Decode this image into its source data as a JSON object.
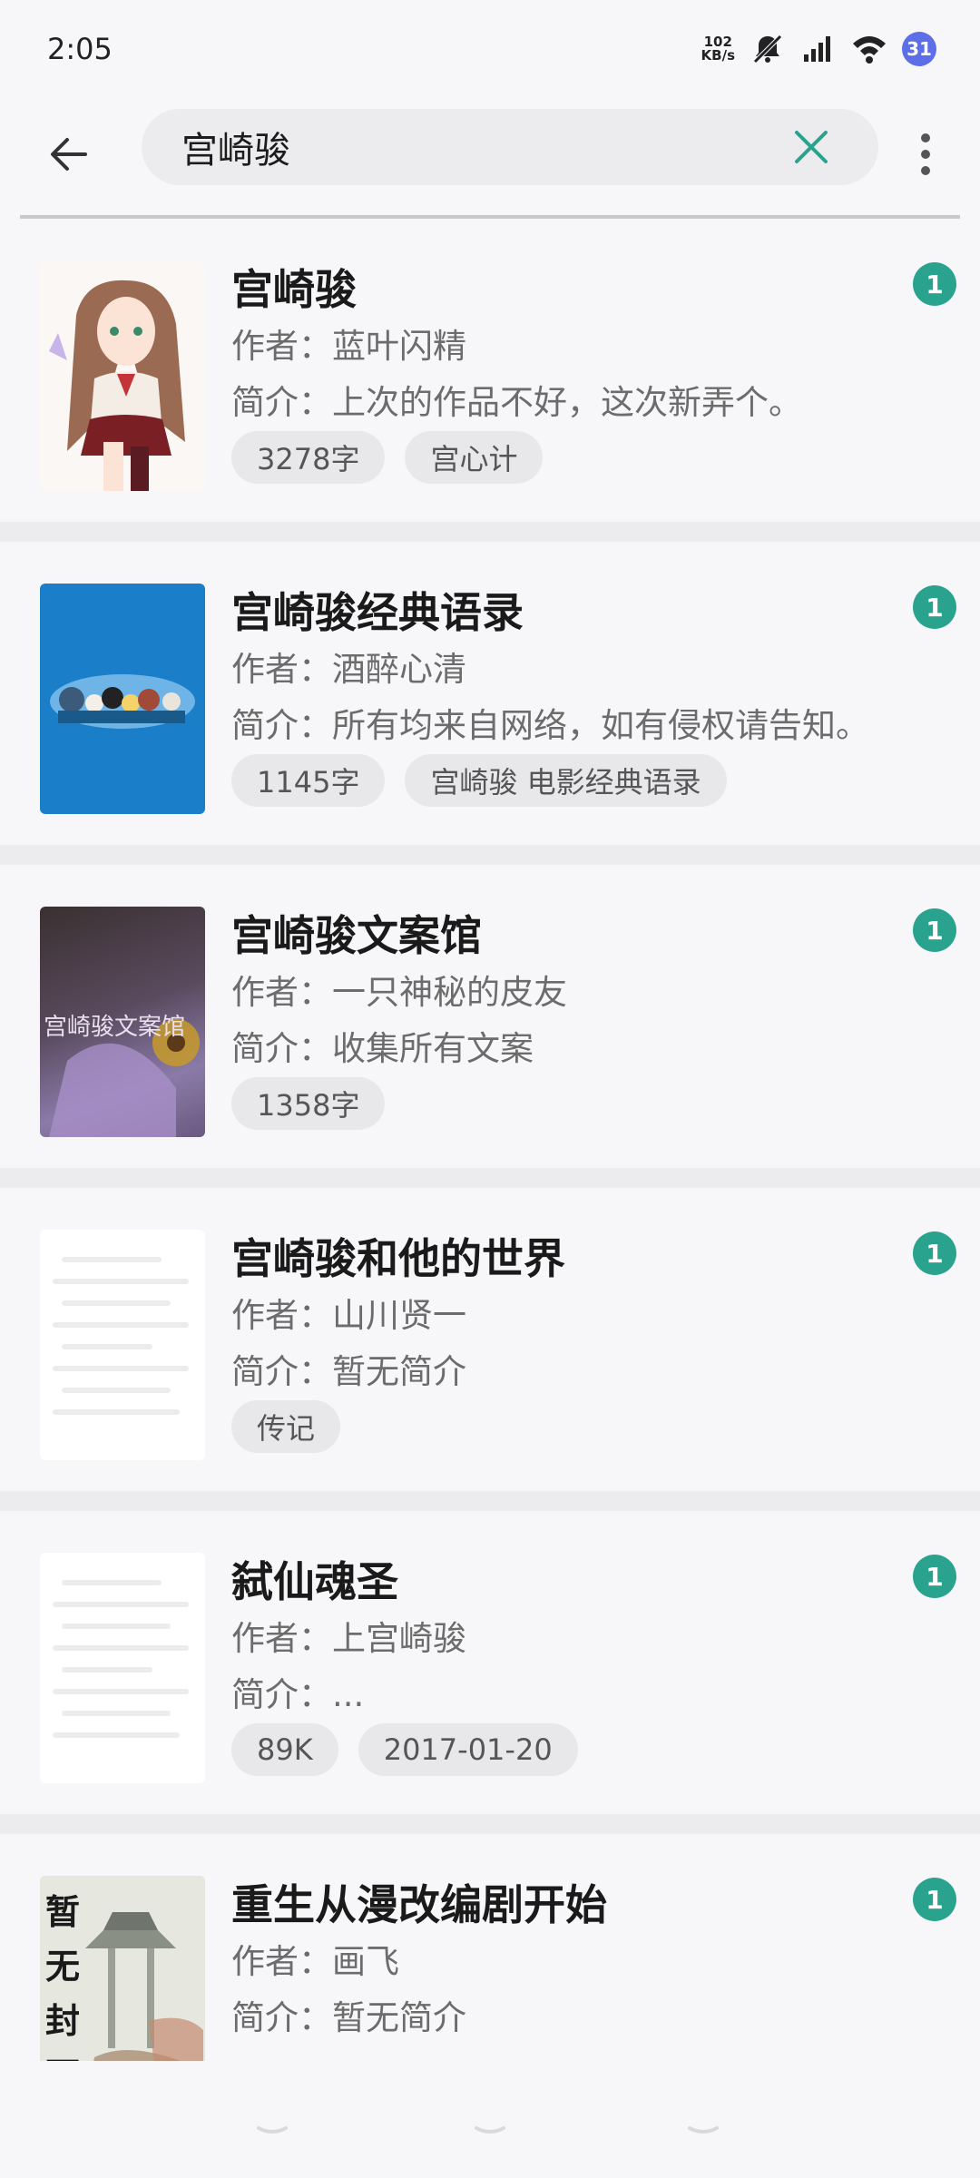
{
  "status": {
    "time": "2:05",
    "net_speed_value": "102",
    "net_speed_unit": "KB/s",
    "notification_count": "31"
  },
  "search": {
    "query": "宫崎骏"
  },
  "colors": {
    "badge": "#2aa38e",
    "accent_clear": "#2aa38e",
    "notif": "#5c6ee8"
  },
  "books": [
    {
      "title": "宫崎骏",
      "author": "作者：蓝叶闪精",
      "intro": "简介：上次的作品不好，这次新弄个。",
      "tags": [
        "3278字",
        "宫心计"
      ],
      "badge": "1",
      "cover": "anime-girl-illustration"
    },
    {
      "title": "宫崎骏经典语录",
      "author": "作者：酒醉心清",
      "intro": "简介：所有均来自网络，如有侵权请告知。",
      "tags": [
        "1145字",
        "宫崎骏 电影经典语录"
      ],
      "badge": "1",
      "cover": "blue-characters-illustration"
    },
    {
      "title": "宫崎骏文案馆",
      "author": "作者：一只神秘的皮友",
      "intro": "简介：收集所有文案",
      "tags": [
        "1358字"
      ],
      "badge": "1",
      "cover": "purple-sunflower-cover",
      "cover_text": "宫崎骏文案馆"
    },
    {
      "title": "宫崎骏和他的世界",
      "author": "作者：山川贤一",
      "intro": "简介：暂无简介",
      "tags": [
        "传记"
      ],
      "badge": "1",
      "cover": "placeholder"
    },
    {
      "title": "弑仙魂圣",
      "author": "作者：上宫崎骏",
      "intro": "简介：...",
      "tags": [
        "89K",
        "2017-01-20"
      ],
      "badge": "1",
      "cover": "placeholder"
    },
    {
      "title": "重生从漫改编剧开始",
      "author": "作者：画飞",
      "intro": "简介：暂无简介",
      "tags": [],
      "badge": "1",
      "cover": "no-cover-pavilion",
      "cover_text": [
        "暂",
        "无",
        "封",
        "面"
      ]
    }
  ]
}
